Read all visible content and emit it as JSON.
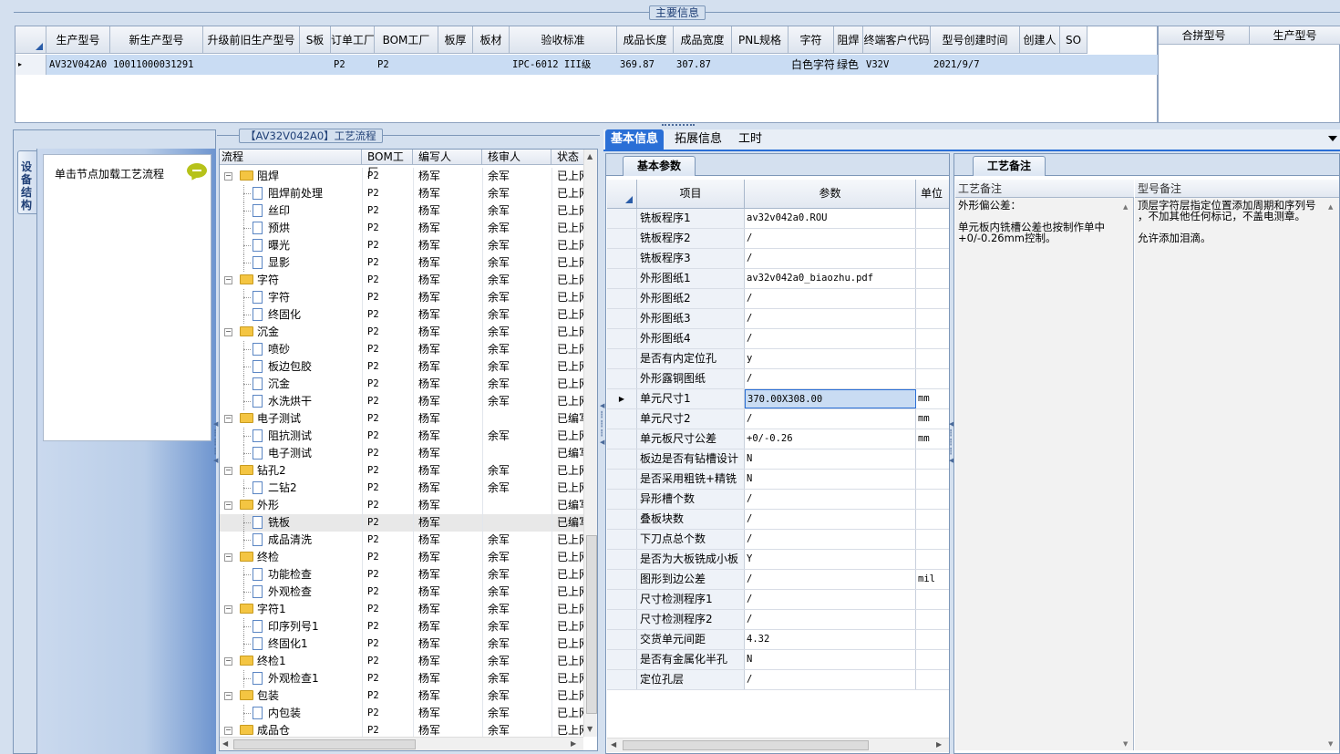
{
  "main_info": {
    "title": "主要信息",
    "columns": [
      "生产型号",
      "新生产型号",
      "升级前旧生产型号",
      "S板",
      "订单工厂",
      "BOM工厂",
      "板厚",
      "板材",
      "验收标准",
      "成品长度",
      "成品宽度",
      "PNL规格",
      "字符",
      "阻焊",
      "终端客户代码",
      "型号创建时间",
      "创建人",
      "SO"
    ],
    "row": {
      "indicator": "▸",
      "生产型号": "AV32V042A0",
      "新生产型号": "10011000031291",
      "升级前旧生产型号": "",
      "S板": "",
      "订单工厂": "P2",
      "BOM工厂": "P2",
      "板厚": "",
      "板材": "",
      "验收标准": "IPC-6012 III级",
      "成品长度": "369.87",
      "成品宽度": "307.87",
      "PNL规格": "",
      "字符": "白色字符",
      "阻焊": "绿色",
      "终端客户代码": "V32V",
      "型号创建时间": "2021/9/7",
      "创建人": "",
      "SO": ""
    },
    "side_columns": [
      "合拼型号",
      "生产型号"
    ]
  },
  "left_panel": {
    "vertical_tab": "设备结构",
    "hint": "单击节点加载工艺流程"
  },
  "process": {
    "title": "【AV32V042A0】工艺流程",
    "columns": [
      "流程",
      "BOM工厂",
      "编写人",
      "核审人",
      "状态"
    ],
    "rows": [
      {
        "level": 0,
        "name": "阻焊",
        "bom": "P2",
        "writer": "杨军",
        "reviewer": "余军",
        "status": "已上网"
      },
      {
        "level": 1,
        "name": "阻焊前处理",
        "bom": "P2",
        "writer": "杨军",
        "reviewer": "余军",
        "status": "已上网"
      },
      {
        "level": 1,
        "name": "丝印",
        "bom": "P2",
        "writer": "杨军",
        "reviewer": "余军",
        "status": "已上网"
      },
      {
        "level": 1,
        "name": "预烘",
        "bom": "P2",
        "writer": "杨军",
        "reviewer": "余军",
        "status": "已上网"
      },
      {
        "level": 1,
        "name": "曝光",
        "bom": "P2",
        "writer": "杨军",
        "reviewer": "余军",
        "status": "已上网"
      },
      {
        "level": 1,
        "name": "显影",
        "bom": "P2",
        "writer": "杨军",
        "reviewer": "余军",
        "status": "已上网"
      },
      {
        "level": 0,
        "name": "字符",
        "bom": "P2",
        "writer": "杨军",
        "reviewer": "余军",
        "status": "已上网"
      },
      {
        "level": 1,
        "name": "字符",
        "bom": "P2",
        "writer": "杨军",
        "reviewer": "余军",
        "status": "已上网"
      },
      {
        "level": 1,
        "name": "终固化",
        "bom": "P2",
        "writer": "杨军",
        "reviewer": "余军",
        "status": "已上网"
      },
      {
        "level": 0,
        "name": "沉金",
        "bom": "P2",
        "writer": "杨军",
        "reviewer": "余军",
        "status": "已上网"
      },
      {
        "level": 1,
        "name": "喷砂",
        "bom": "P2",
        "writer": "杨军",
        "reviewer": "余军",
        "status": "已上网"
      },
      {
        "level": 1,
        "name": "板边包胶",
        "bom": "P2",
        "writer": "杨军",
        "reviewer": "余军",
        "status": "已上网"
      },
      {
        "level": 1,
        "name": "沉金",
        "bom": "P2",
        "writer": "杨军",
        "reviewer": "余军",
        "status": "已上网"
      },
      {
        "level": 1,
        "name": "水洗烘干",
        "bom": "P2",
        "writer": "杨军",
        "reviewer": "余军",
        "status": "已上网"
      },
      {
        "level": 0,
        "name": "电子测试",
        "bom": "P2",
        "writer": "杨军",
        "reviewer": "",
        "status": "已编写"
      },
      {
        "level": 1,
        "name": "阻抗测试",
        "bom": "P2",
        "writer": "杨军",
        "reviewer": "余军",
        "status": "已上网"
      },
      {
        "level": 1,
        "name": "电子测试",
        "bom": "P2",
        "writer": "杨军",
        "reviewer": "",
        "status": "已编写"
      },
      {
        "level": 0,
        "name": "钻孔2",
        "bom": "P2",
        "writer": "杨军",
        "reviewer": "余军",
        "status": "已上网"
      },
      {
        "level": 1,
        "name": "二钻2",
        "bom": "P2",
        "writer": "杨军",
        "reviewer": "余军",
        "status": "已上网"
      },
      {
        "level": 0,
        "name": "外形",
        "bom": "P2",
        "writer": "杨军",
        "reviewer": "",
        "status": "已编写"
      },
      {
        "level": 1,
        "name": "铣板",
        "bom": "P2",
        "writer": "杨军",
        "reviewer": "",
        "status": "已编写",
        "selected": true
      },
      {
        "level": 1,
        "name": "成品清洗",
        "bom": "P2",
        "writer": "杨军",
        "reviewer": "余军",
        "status": "已上网"
      },
      {
        "level": 0,
        "name": "终检",
        "bom": "P2",
        "writer": "杨军",
        "reviewer": "余军",
        "status": "已上网"
      },
      {
        "level": 1,
        "name": "功能检查",
        "bom": "P2",
        "writer": "杨军",
        "reviewer": "余军",
        "status": "已上网"
      },
      {
        "level": 1,
        "name": "外观检查",
        "bom": "P2",
        "writer": "杨军",
        "reviewer": "余军",
        "status": "已上网"
      },
      {
        "level": 0,
        "name": "字符1",
        "bom": "P2",
        "writer": "杨军",
        "reviewer": "余军",
        "status": "已上网"
      },
      {
        "level": 1,
        "name": "印序列号1",
        "bom": "P2",
        "writer": "杨军",
        "reviewer": "余军",
        "status": "已上网"
      },
      {
        "level": 1,
        "name": "终固化1",
        "bom": "P2",
        "writer": "杨军",
        "reviewer": "余军",
        "status": "已上网"
      },
      {
        "level": 0,
        "name": "终检1",
        "bom": "P2",
        "writer": "杨军",
        "reviewer": "余军",
        "status": "已上网"
      },
      {
        "level": 1,
        "name": "外观检查1",
        "bom": "P2",
        "writer": "杨军",
        "reviewer": "余军",
        "status": "已上网"
      },
      {
        "level": 0,
        "name": "包装",
        "bom": "P2",
        "writer": "杨军",
        "reviewer": "余军",
        "status": "已上网"
      },
      {
        "level": 1,
        "name": "内包装",
        "bom": "P2",
        "writer": "杨军",
        "reviewer": "余军",
        "status": "已上网"
      },
      {
        "level": 0,
        "name": "成品仓",
        "bom": "P2",
        "writer": "杨军",
        "reviewer": "余军",
        "status": "已上网"
      }
    ]
  },
  "tabs": [
    "基本信息",
    "拓展信息",
    "工时"
  ],
  "basic_params": {
    "tab": "基本参数",
    "columns": [
      "项目",
      "参数",
      "单位"
    ],
    "rows": [
      {
        "k": "铣板程序1",
        "v": "av32v042a0.ROU",
        "u": ""
      },
      {
        "k": "铣板程序2",
        "v": "/",
        "u": ""
      },
      {
        "k": "铣板程序3",
        "v": "/",
        "u": ""
      },
      {
        "k": "外形图纸1",
        "v": "av32v042a0_biaozhu.pdf",
        "u": ""
      },
      {
        "k": "外形图纸2",
        "v": "/",
        "u": ""
      },
      {
        "k": "外形图纸3",
        "v": "/",
        "u": ""
      },
      {
        "k": "外形图纸4",
        "v": "/",
        "u": ""
      },
      {
        "k": "是否有内定位孔",
        "v": "y",
        "u": ""
      },
      {
        "k": "外形露铜图纸",
        "v": "/",
        "u": ""
      },
      {
        "k": "单元尺寸1",
        "v": "370.00X308.00",
        "u": "mm",
        "current": true
      },
      {
        "k": "单元尺寸2",
        "v": "/",
        "u": "mm"
      },
      {
        "k": "单元板尺寸公差",
        "v": "+0/-0.26",
        "u": "mm"
      },
      {
        "k": "板边是否有钻槽设计",
        "v": "N",
        "u": ""
      },
      {
        "k": "是否采用粗铣+精铣",
        "v": "N",
        "u": ""
      },
      {
        "k": "异形槽个数",
        "v": "/",
        "u": ""
      },
      {
        "k": "叠板块数",
        "v": "/",
        "u": ""
      },
      {
        "k": "下刀点总个数",
        "v": "/",
        "u": ""
      },
      {
        "k": "是否为大板铣成小板",
        "v": "Y",
        "u": ""
      },
      {
        "k": "图形到边公差",
        "v": "/",
        "u": "mil"
      },
      {
        "k": "尺寸检测程序1",
        "v": "/",
        "u": ""
      },
      {
        "k": "尺寸检测程序2",
        "v": "/",
        "u": ""
      },
      {
        "k": "交货单元间距",
        "v": "4.32",
        "u": ""
      },
      {
        "k": "是否有金属化半孔",
        "v": "N",
        "u": ""
      },
      {
        "k": "定位孔层",
        "v": "/",
        "u": ""
      }
    ]
  },
  "remarks": {
    "tab": "工艺备注",
    "process_header": "工艺备注",
    "model_header": "型号备注",
    "process_lines": [
      "外形偏公差：",
      "",
      "单元板内铣槽公差也按制作单中",
      "+0/-0.26mm控制。"
    ],
    "model_lines": [
      "顶层字符层指定位置添加周期和序列号",
      "，不加其他任何标记，不盖电测章。",
      "",
      "允许添加泪滴。"
    ]
  }
}
